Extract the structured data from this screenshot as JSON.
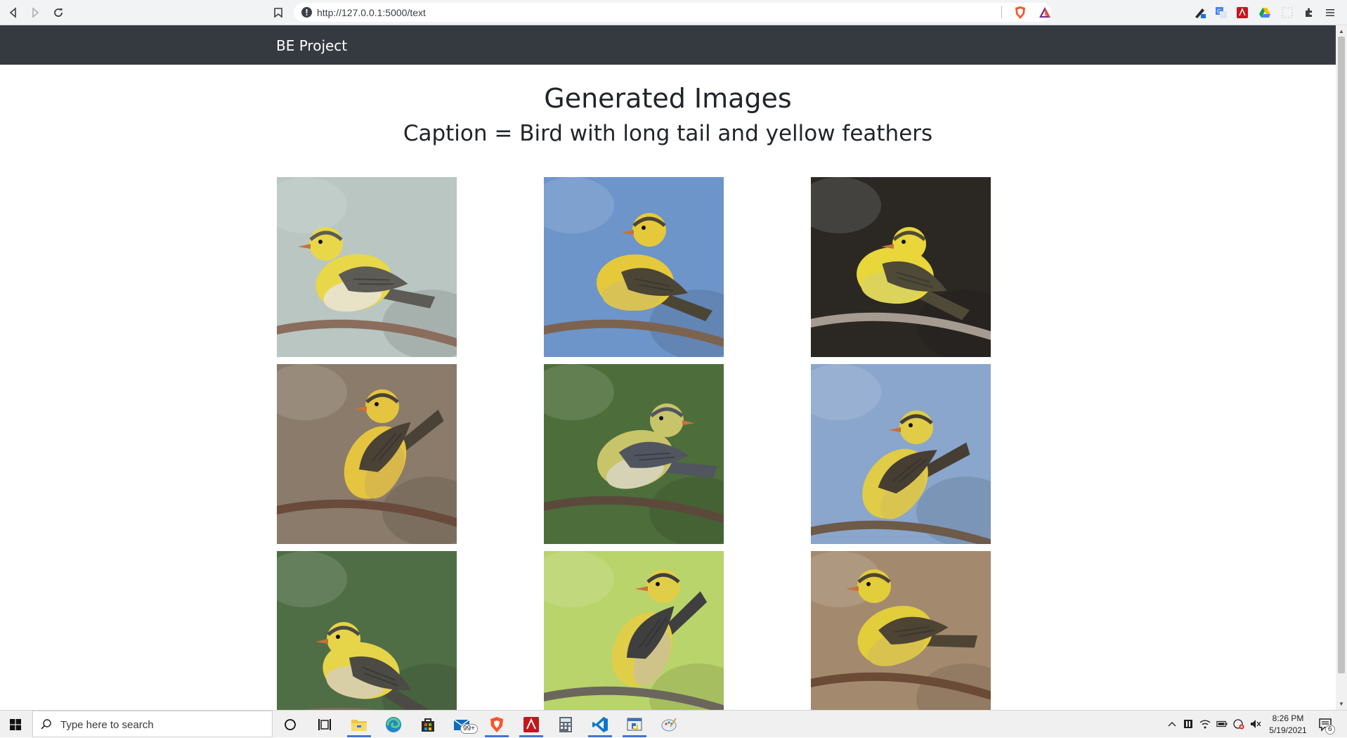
{
  "browser": {
    "url": "http://127.0.0.1:5000/text",
    "icons": [
      "back-icon",
      "forward-icon",
      "reload-icon",
      "bookmark-icon",
      "site-info-icon",
      "brave-shields-icon",
      "brave-rewards-icon",
      "extensions-icon",
      "menu-icon"
    ]
  },
  "navbar": {
    "brand": "BE Project",
    "background": "#343a40"
  },
  "main": {
    "title": "Generated Images",
    "caption": "Caption = Bird with long tail and yellow feathers",
    "images": [
      {
        "name": "generated-bird-1",
        "palette": {
          "bg": "#b9c6c2",
          "body": "#e9d74a",
          "wing": "#5d5b55",
          "belly": "#e8e2c6",
          "branch": "#8a6d5c"
        }
      },
      {
        "name": "generated-bird-2",
        "palette": {
          "bg": "#6e95c9",
          "body": "#e6c93b",
          "wing": "#4b4536",
          "belly": "#d9c255",
          "branch": "#7c6350"
        }
      },
      {
        "name": "generated-bird-3",
        "palette": {
          "bg": "#2b2824",
          "body": "#e8d63b",
          "wing": "#4e4a37",
          "belly": "#dcd45a",
          "branch": "#a59b90"
        }
      },
      {
        "name": "generated-bird-4",
        "palette": {
          "bg": "#8a7b6a",
          "body": "#e5c440",
          "wing": "#4a4236",
          "belly": "#d8b84a",
          "branch": "#6a4a3a"
        }
      },
      {
        "name": "generated-bird-5",
        "palette": {
          "bg": "#4d6e3a",
          "body": "#c8c46a",
          "wing": "#505560",
          "belly": "#d6d2b6",
          "branch": "#5b4a3c"
        }
      },
      {
        "name": "generated-bird-6",
        "palette": {
          "bg": "#8aa6cc",
          "body": "#e0cc46",
          "wing": "#463e33",
          "belly": "#d9c450",
          "branch": "#6d5a48"
        }
      },
      {
        "name": "generated-bird-7",
        "palette": {
          "bg": "#4f6e46",
          "body": "#e6d449",
          "wing": "#4b4a44",
          "belly": "#d8cfa6",
          "branch": "#7c6a5a"
        }
      },
      {
        "name": "generated-bird-8",
        "palette": {
          "bg": "#b9d46a",
          "body": "#e1ce48",
          "wing": "#3f3f3f",
          "belly": "#cfc38a",
          "branch": "#6a665c"
        }
      },
      {
        "name": "generated-bird-9",
        "palette": {
          "bg": "#a38a6e",
          "body": "#e2cd3a",
          "wing": "#4e4434",
          "belly": "#d9c24e",
          "branch": "#6b4a36"
        }
      }
    ]
  },
  "taskbar": {
    "search_placeholder": "Type here to search",
    "mail_badge": "99+",
    "time": "8:26 PM",
    "date": "5/19/2021",
    "notification_count": "6",
    "accent": "#3a78d4"
  }
}
